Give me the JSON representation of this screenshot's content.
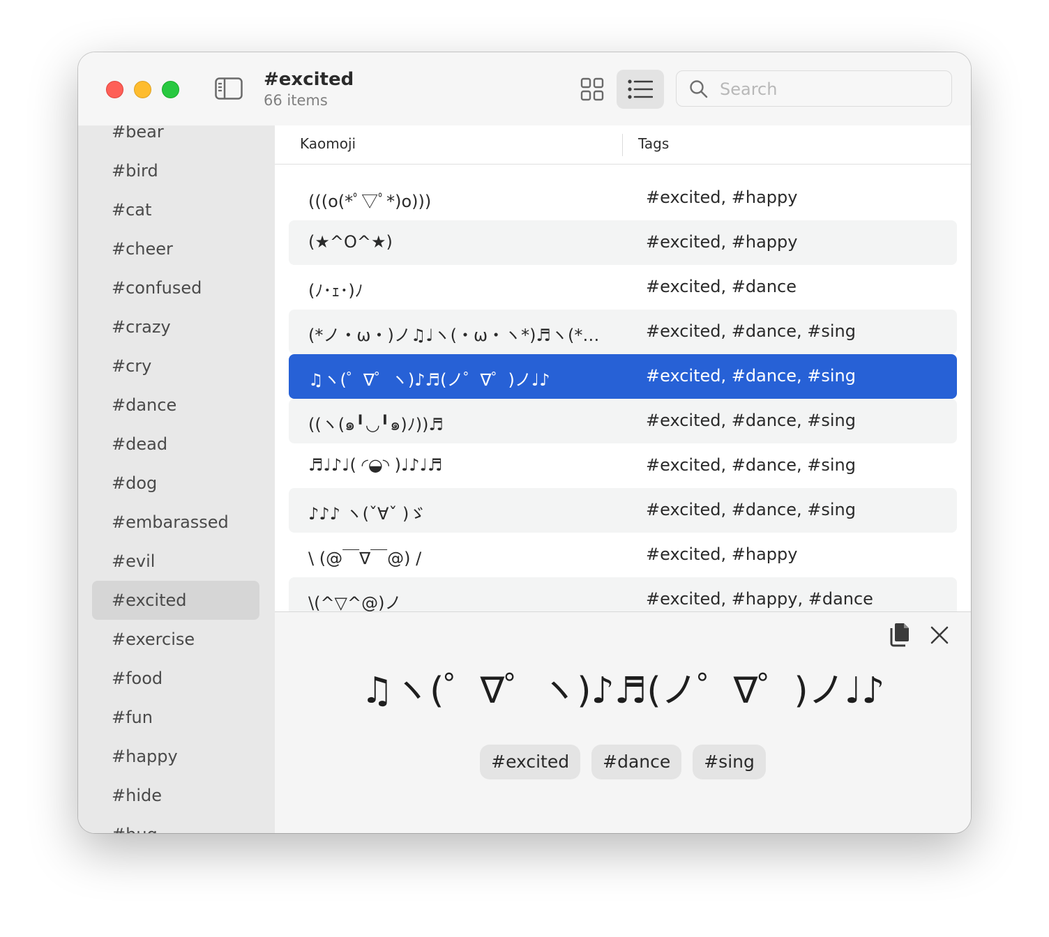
{
  "window": {
    "title": "#excited",
    "subtitle": "66 items"
  },
  "search": {
    "placeholder": "Search",
    "value": ""
  },
  "toolbar": {
    "grid_view_icon": "grid-icon",
    "list_view_icon": "list-icon",
    "sidebar_toggle_icon": "sidebar-icon",
    "active_view": "list"
  },
  "sidebar": {
    "items": [
      {
        "label": "#bear"
      },
      {
        "label": "#bird"
      },
      {
        "label": "#cat"
      },
      {
        "label": "#cheer"
      },
      {
        "label": "#confused"
      },
      {
        "label": "#crazy"
      },
      {
        "label": "#cry"
      },
      {
        "label": "#dance"
      },
      {
        "label": "#dead"
      },
      {
        "label": "#dog"
      },
      {
        "label": "#embarassed"
      },
      {
        "label": "#evil"
      },
      {
        "label": "#excited",
        "selected": true
      },
      {
        "label": "#exercise"
      },
      {
        "label": "#food"
      },
      {
        "label": "#fun"
      },
      {
        "label": "#happy"
      },
      {
        "label": "#hide"
      },
      {
        "label": "#hug"
      }
    ]
  },
  "table": {
    "columns": [
      "Kaomoji",
      "Tags"
    ],
    "rows": [
      {
        "kaomoji": "(((o(*ﾟ▽ﾟ*)o)))",
        "tags": "#excited, #happy"
      },
      {
        "kaomoji": "(★^O^★)",
        "tags": "#excited, #happy"
      },
      {
        "kaomoji": "(ﾉ･ｪ･)ﾉ",
        "tags": "#excited, #dance"
      },
      {
        "kaomoji": "(*ノ・ω・)ノ♫♩ヽ(・ω・ヽ*)♬ヽ(*・ω・)ノ♪",
        "tags": "#excited, #dance, #sing"
      },
      {
        "kaomoji": "♫ヽ(゜∇゜ヽ)♪♬(ノ゜∇゜)ノ♩♪",
        "tags": "#excited, #dance, #sing",
        "selected": true
      },
      {
        "kaomoji": "((ヽ(๑╹◡╹๑)ﾉ))♬",
        "tags": "#excited, #dance, #sing"
      },
      {
        "kaomoji": "♬♩♪♩( ◜◒◝ )♩♪♩♬",
        "tags": "#excited, #dance, #sing"
      },
      {
        "kaomoji": "♪♪♪ ヽ(ˇ∀ˇ )ゞ",
        "tags": "#excited, #dance, #sing"
      },
      {
        "kaomoji": "\\ (@￣∇￣@) /",
        "tags": "#excited, #happy"
      },
      {
        "kaomoji": "\\(^▽^@)ノ",
        "tags": "#excited, #happy, #dance"
      }
    ]
  },
  "detail": {
    "kaomoji": "♫ヽ(゜∇゜ヽ)♪♬(ノ゜∇゜)ノ♩♪",
    "tags": [
      "#excited",
      "#dance",
      "#sing"
    ],
    "copy_icon": "copy-icon",
    "close_icon": "close-icon"
  }
}
